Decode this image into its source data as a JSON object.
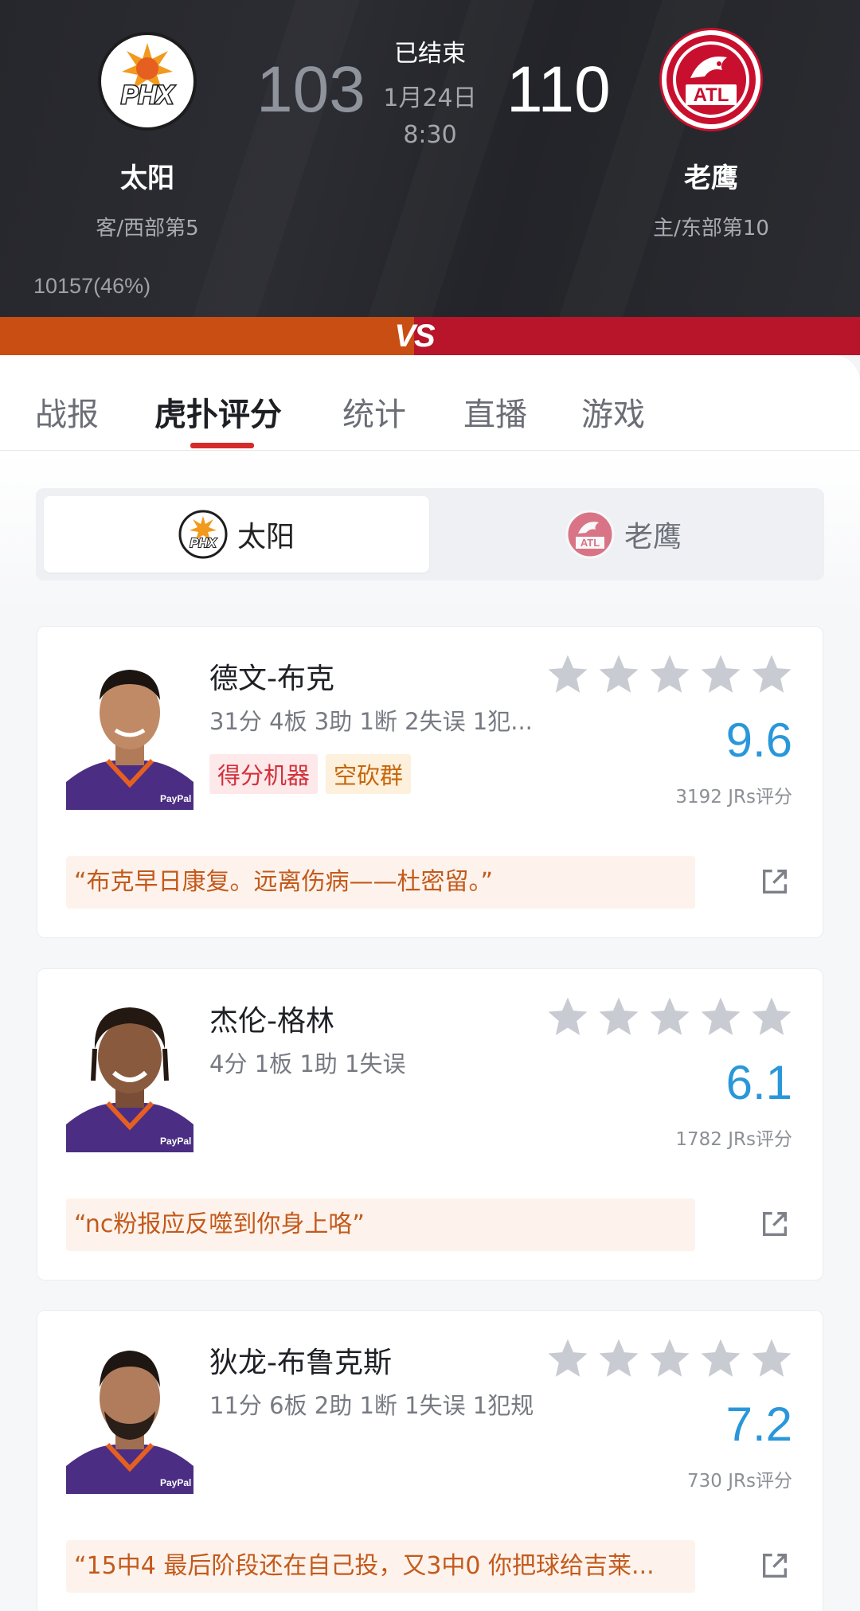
{
  "game": {
    "status": "已结束",
    "date": "1月24日",
    "time": "8:30",
    "away": {
      "name": "太阳",
      "abbr": "PHX",
      "score": "103",
      "subtitle": "客/西部第5"
    },
    "home": {
      "name": "老鹰",
      "abbr": "ATL",
      "score": "110",
      "subtitle": "主/东部第10"
    },
    "hupu_count": "10157(46%)",
    "vs_label": "VS"
  },
  "tabs": [
    {
      "label": "战报"
    },
    {
      "label": "虎扑评分"
    },
    {
      "label": "统计"
    },
    {
      "label": "直播"
    },
    {
      "label": "游戏"
    }
  ],
  "switcher": {
    "active": "太阳",
    "inactive": "老鹰"
  },
  "players": [
    {
      "name": "德文-布克",
      "stats": "31分 4板 3助 1断 2失误 1犯...",
      "tags": [
        "得分机器",
        "空砍群"
      ],
      "rating": "9.6",
      "rating_count": "3192 JRs评分",
      "quote": "“布克早日康复。远离伤病——杜密留。”"
    },
    {
      "name": "杰伦-格林",
      "stats": "4分 1板 1助 1失误",
      "tags": [],
      "rating": "6.1",
      "rating_count": "1782 JRs评分",
      "quote": "“nc粉报应反噬到你身上咯”"
    },
    {
      "name": "狄龙-布鲁克斯",
      "stats": "11分 6板 2助 1断 1失误 1犯规",
      "tags": [],
      "rating": "7.2",
      "rating_count": "730 JRs评分",
      "quote": "“15中4 最后阶段还在自己投，又3中0 你把球给吉莱..."
    }
  ],
  "colors": {
    "header_bg": "#26272c",
    "accent_red": "#d62b2b",
    "rating_blue": "#2a97da",
    "quote_text": "#c35a1c",
    "star_gray": "#c9cbd3"
  }
}
